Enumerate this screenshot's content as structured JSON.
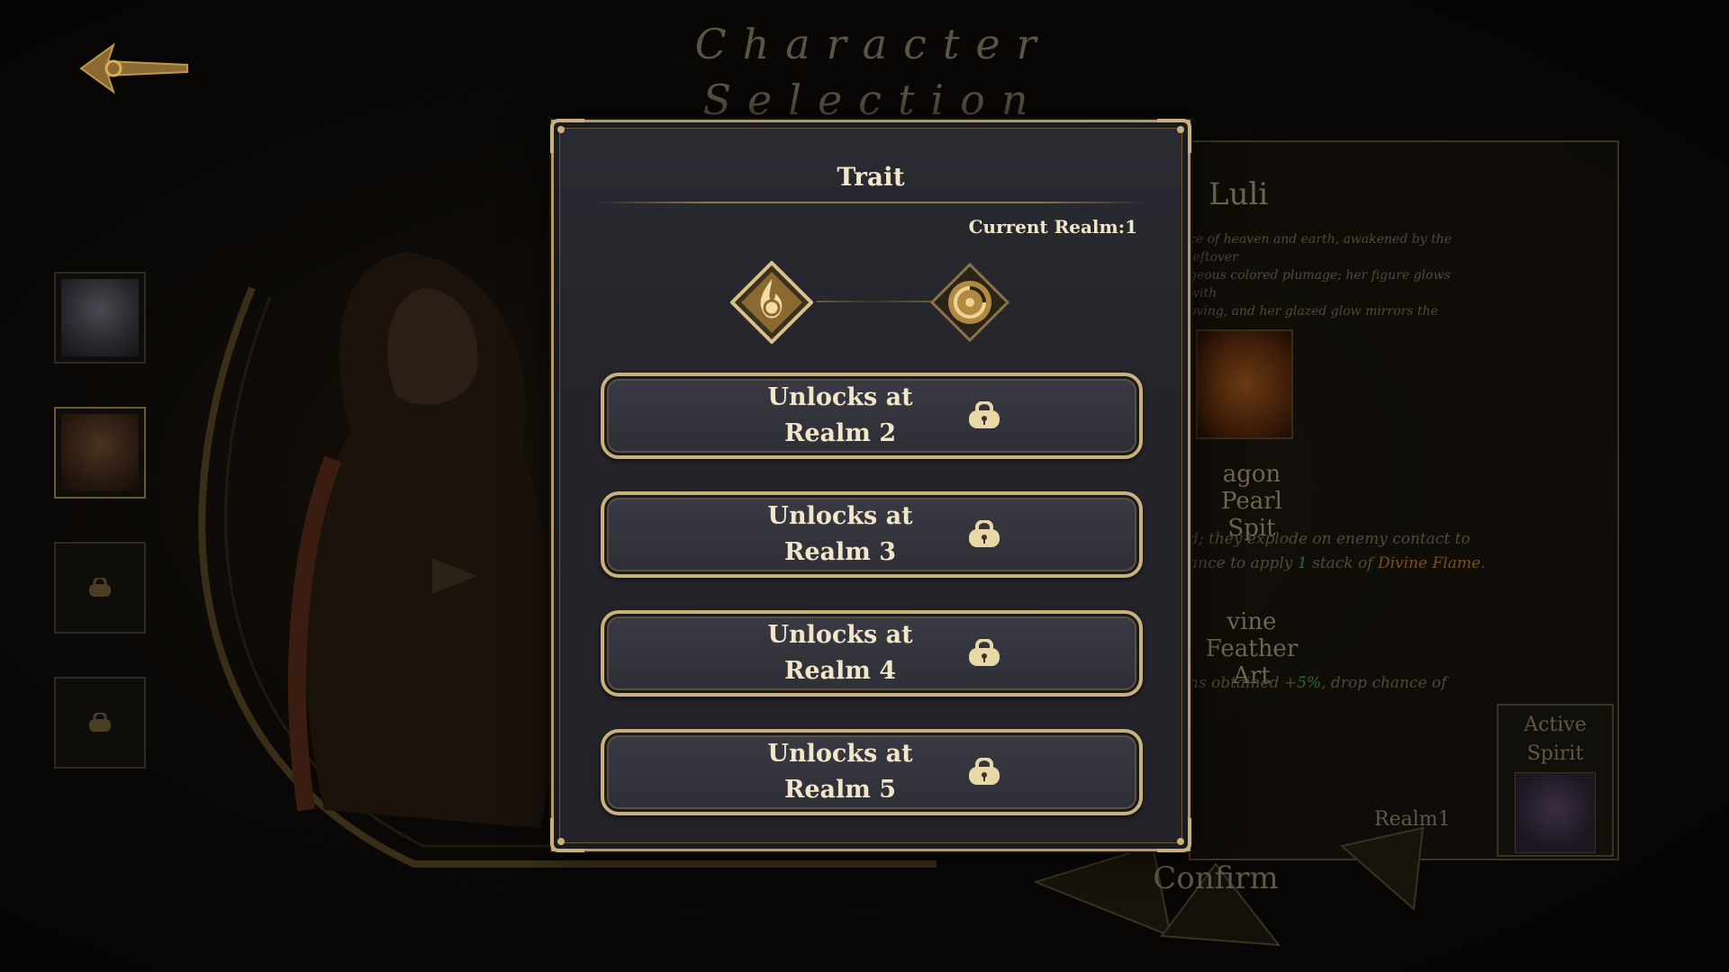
{
  "screen": {
    "title": "Character Selection",
    "back_icon": "arrow-left-icon"
  },
  "roster": {
    "slots": [
      {
        "state": "unlocked",
        "portrait": "silver-haired-character"
      },
      {
        "state": "selected",
        "portrait": "luli"
      },
      {
        "state": "locked",
        "icon": "lock-icon"
      },
      {
        "state": "locked",
        "icon": "lock-icon"
      }
    ]
  },
  "character_panel": {
    "name": "Luli",
    "description_lines": [
      "ce of heaven and earth, awakened by the leftover",
      "geous colored plumage; her figure glows with",
      "oving, and her glazed glow mirrors the"
    ],
    "skills": [
      {
        "title_lines": [
          "agon Pearl",
          "Spit"
        ],
        "desc_line1": "d; they explode on enemy contact to",
        "desc_line2_pre": "ance to apply ",
        "desc_line2_num": "1",
        "desc_line2_mid": " stack of ",
        "desc_line2_keyword": "Divine Flame",
        "desc_line2_post": "."
      },
      {
        "title_lines": [
          "vine Feather",
          "Art"
        ],
        "desc_pre": "ns obtained +",
        "desc_num": "5%",
        "desc_post": ", drop chance of"
      }
    ],
    "active_spirit_label_line1": "Active",
    "active_spirit_label_line2": "Spirit",
    "realm_label": "Realm1",
    "confirm_label": "Confirm"
  },
  "trait_modal": {
    "title": "Trait",
    "current_realm": "Current Realm:1",
    "trait_icons": [
      "flame-trait-icon",
      "spiral-trait-icon"
    ],
    "unlocks": [
      {
        "line1": "Unlocks at",
        "line2": "Realm 2"
      },
      {
        "line1": "Unlocks at",
        "line2": "Realm 3"
      },
      {
        "line1": "Unlocks at",
        "line2": "Realm 4"
      },
      {
        "line1": "Unlocks at",
        "line2": "Realm 5"
      }
    ]
  },
  "colors": {
    "gold": "#c8b27a",
    "text_light": "#f2e6c8",
    "modal_bg": "#26262c",
    "highlight_green": "#2e6a2e",
    "highlight_orange": "#7a5020"
  }
}
